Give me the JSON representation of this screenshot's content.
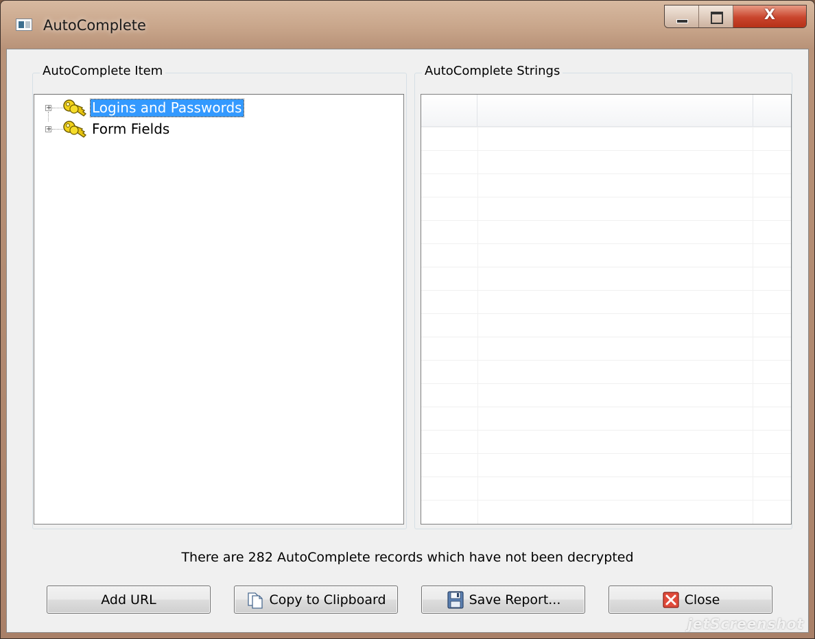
{
  "window": {
    "title": "AutoComplete",
    "close_glyph": "X"
  },
  "left_group": {
    "title": "AutoComplete Item",
    "items": [
      {
        "label": "Logins and Passwords",
        "selected": true,
        "icon": "key-icon"
      },
      {
        "label": "Form Fields",
        "selected": false,
        "icon": "key-icon"
      }
    ]
  },
  "right_group": {
    "title": "AutoComplete Strings"
  },
  "status": "There are 282 AutoComplete records which have not been decrypted",
  "buttons": {
    "add_url": "Add URL",
    "copy": "Copy to Clipboard",
    "save": "Save Report...",
    "close": "Close"
  },
  "watermark": "jetScreenshot",
  "colors": {
    "selection": "#3399ff",
    "close_red": "#c9452d"
  }
}
